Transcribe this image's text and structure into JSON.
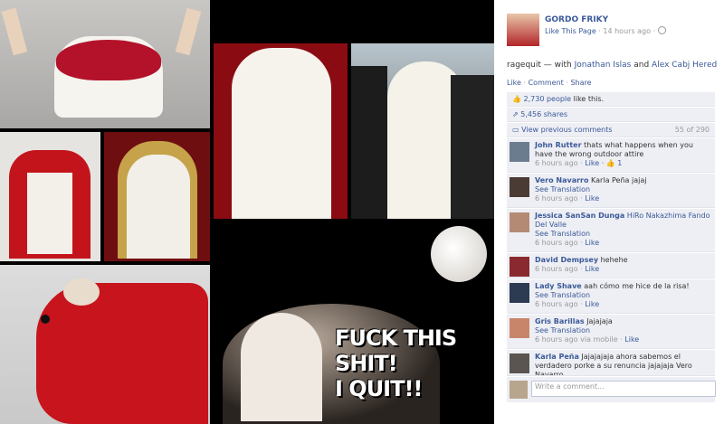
{
  "meme": {
    "text_line1": "FUCK THIS SHIT!",
    "text_line2": "I QUIT!!"
  },
  "post": {
    "page_name": "GORDO FRIKY",
    "like_page": "Like This Page",
    "time": "14 hours ago",
    "caption_text": "ragequit — with",
    "tag1": "Jonathan Islas",
    "and": "and",
    "tag2": "Alex Cabj Heredia.",
    "actions": {
      "like": "Like",
      "comment": "Comment",
      "share": "Share"
    },
    "likes_count": "2,730 people",
    "likes_suffix": "like this.",
    "shares": "5,456 shares",
    "view_previous": "View previous comments",
    "comment_count": "55 of 290"
  },
  "comments": [
    {
      "name": "John Rutter",
      "text": "thats what happens when you have the wrong outdoor attire",
      "meta": "6 hours ago ·",
      "link": "Like",
      "extra": "· 👍 1",
      "avatar_color": "#6b7c8e"
    },
    {
      "name": "Vero Navarro",
      "text": "Karla Peña jajaj",
      "see": "See Translation",
      "meta": "6 hours ago ·",
      "link": "Like",
      "avatar_color": "#4a3c35"
    },
    {
      "name": "Jessica SanSan Dunga",
      "text": "HiRo Nakazhima Fando Del Valle",
      "see": "See Translation",
      "meta": "6 hours ago ·",
      "link": "Like",
      "avatar_color": "#b48a74"
    },
    {
      "name": "David Dempsey",
      "text": "hehehe",
      "meta": "6 hours ago ·",
      "link": "Like",
      "avatar_color": "#8a2a30"
    },
    {
      "name": "Lady Shave",
      "text": "aah cómo me hice de la risa!",
      "see": "See Translation",
      "meta": "6 hours ago ·",
      "link": "Like",
      "avatar_color": "#2c3a52"
    },
    {
      "name": "Gris Barillas",
      "text": "Jajajaja",
      "see": "See Translation",
      "meta": "6 hours ago via mobile ·",
      "link": "Like",
      "avatar_color": "#c9856a"
    },
    {
      "name": "Karla Peña",
      "text": "Jajajajaja ahora sabemos el verdadero porke a su renuncia jajajaja Vero Navarro",
      "meta": "",
      "link": "",
      "avatar_color": "#5a5550"
    }
  ],
  "write_comment": {
    "placeholder": "Write a comment..."
  }
}
